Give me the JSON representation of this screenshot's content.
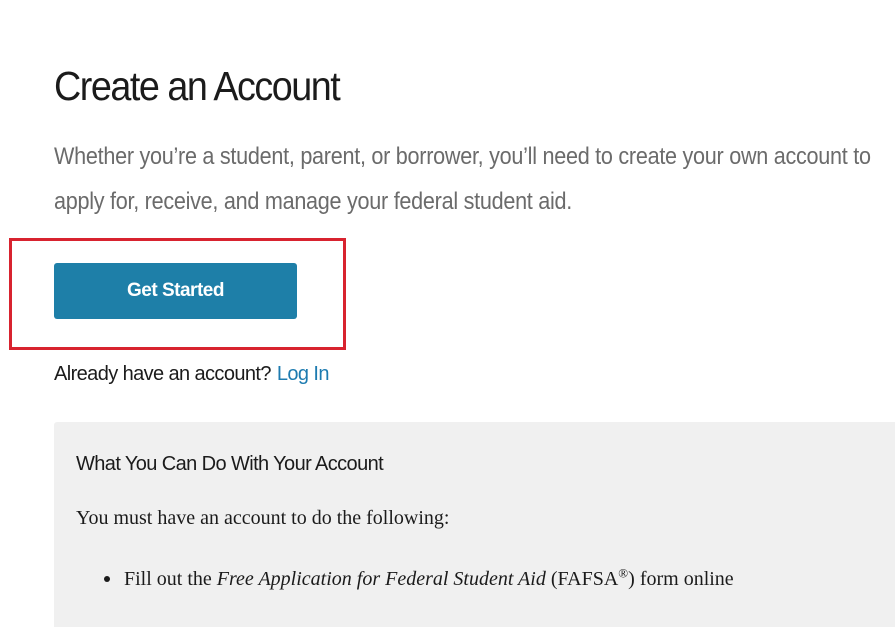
{
  "page": {
    "title": "Create an Account",
    "intro": "Whether you’re a student, parent, or borrower, you’ll need to create your own account to apply for, receive, and manage your federal student aid."
  },
  "actions": {
    "get_started_label": "Get Started",
    "already_text": "Already have an account?",
    "login_label": "Log In"
  },
  "info_panel": {
    "heading": "What You Can Do With Your Account",
    "intro": "You must have an account to do the following:",
    "items": [
      {
        "prefix": "Fill out the ",
        "emphasis": "Free Application for Federal Student Aid",
        "middle": " (FAFSA",
        "superscript": "®",
        "suffix": ") form online"
      }
    ]
  },
  "colors": {
    "button": "#1e7fa8",
    "link": "#1d7bb0",
    "highlight": "#d8232f",
    "panel": "#f0f0f0"
  }
}
